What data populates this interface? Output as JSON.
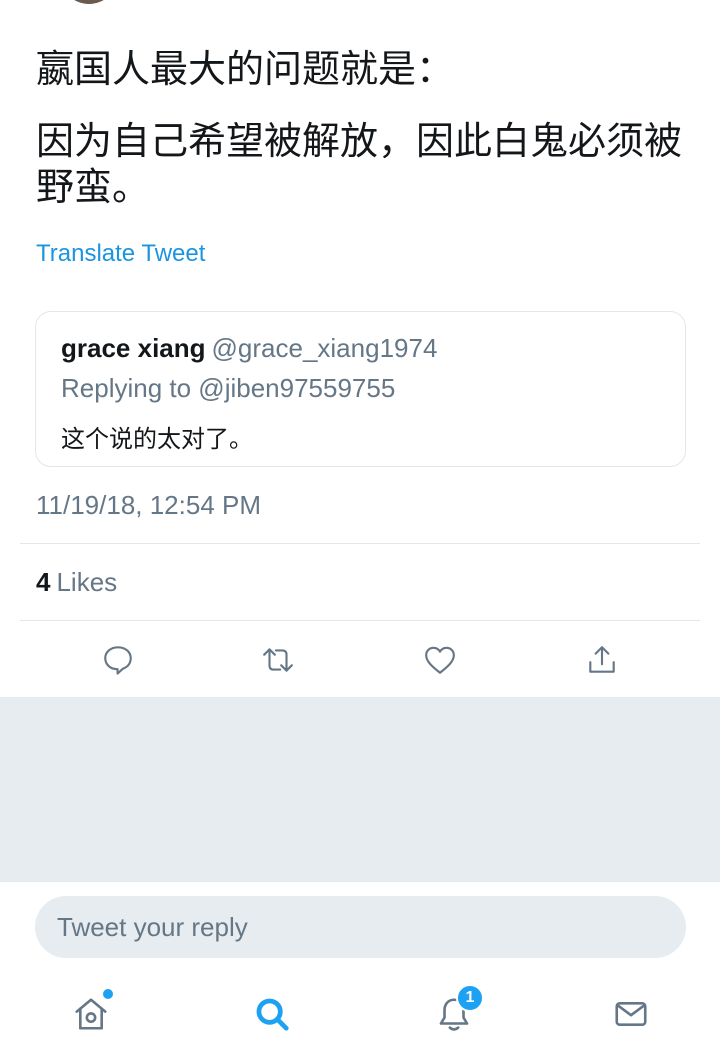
{
  "tweet": {
    "text_line1": "嬴国人最大的问题就是：",
    "text_line2": "因为自己希望被解放，因此白鬼必须被野蛮。",
    "translate_label": "Translate Tweet",
    "timestamp": "11/19/18, 12:54 PM",
    "likes_count": "4",
    "likes_label": "Likes"
  },
  "quoted_tweet": {
    "name": "grace xiang",
    "handle": "@grace_xiang1974",
    "replying_to": "Replying to @jiben97559755",
    "text": "这个说的太对了。"
  },
  "actions": {
    "icons": [
      "reply-icon",
      "retweet-icon",
      "like-icon",
      "share-icon"
    ]
  },
  "reply": {
    "placeholder": "Tweet your reply"
  },
  "bottom_nav": {
    "items": [
      "home-icon",
      "search-icon",
      "notifications-icon",
      "messages-icon"
    ],
    "active": "search-icon",
    "notification_badge": "1",
    "accent_color": "#1da1f2"
  }
}
